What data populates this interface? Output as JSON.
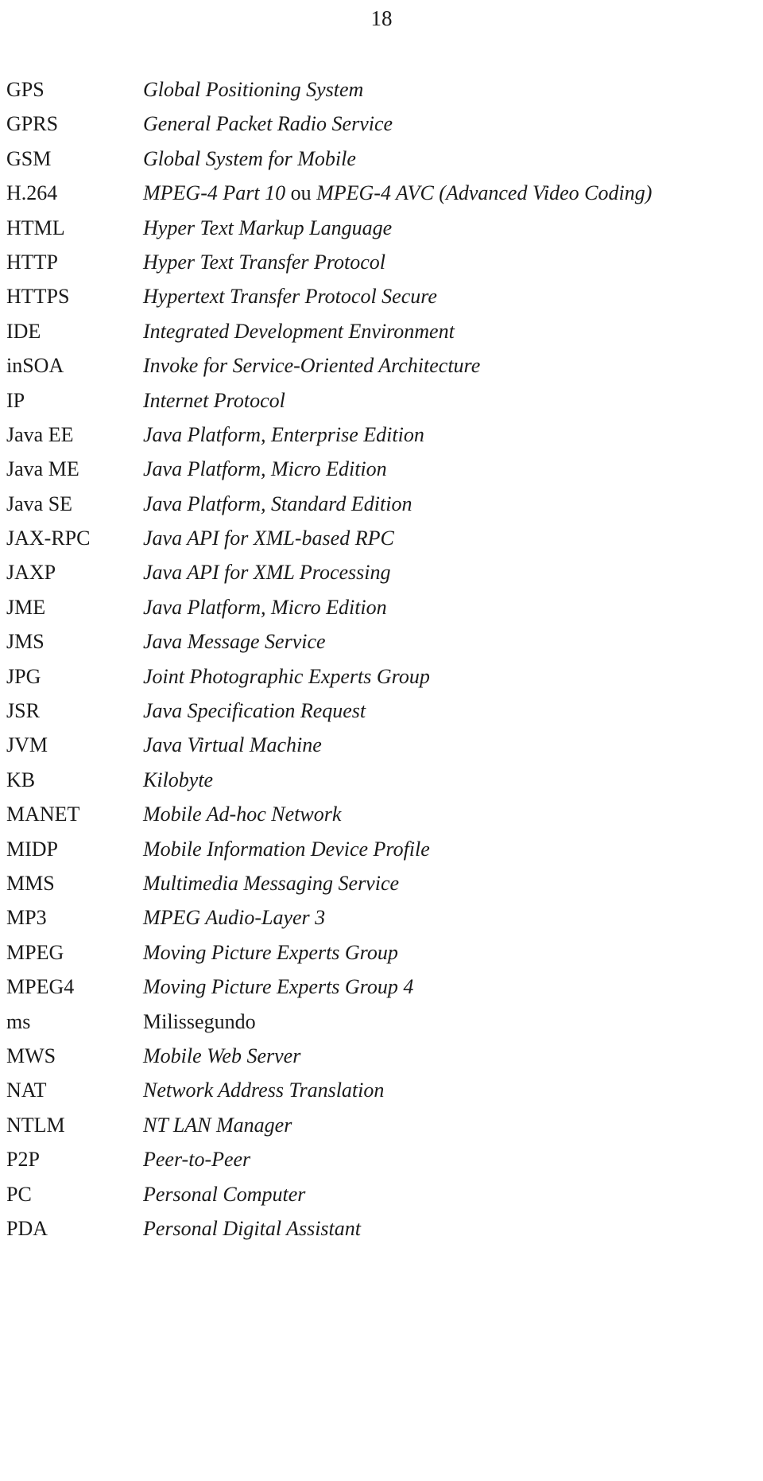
{
  "page": {
    "number": "18"
  },
  "glossary": {
    "entries": [
      {
        "term": "GPS",
        "definition": "Global Positioning System",
        "italic": true
      },
      {
        "term": "GPRS",
        "definition": "General Packet Radio Service",
        "italic": true
      },
      {
        "term": "GSM",
        "definition": "Global System for Mobile",
        "italic": true
      },
      {
        "term": "H.264",
        "definition": "MPEG-4 Part 10 ou MPEG-4 AVC (Advanced Video Coding)",
        "italic": true,
        "roman_segments": [
          "ou"
        ]
      },
      {
        "term": "HTML",
        "definition": "Hyper Text Markup Language",
        "italic": true
      },
      {
        "term": "HTTP",
        "definition": "Hyper Text Transfer Protocol",
        "italic": true
      },
      {
        "term": "HTTPS",
        "definition": "Hypertext Transfer Protocol Secure",
        "italic": true
      },
      {
        "term": "IDE",
        "definition": "Integrated Development Environment",
        "italic": true
      },
      {
        "term": "inSOA",
        "definition": "Invoke for Service-Oriented Architecture",
        "italic": true
      },
      {
        "term": "IP",
        "definition": "Internet Protocol",
        "italic": true
      },
      {
        "term": "Java EE",
        "definition": "Java Platform, Enterprise Edition",
        "italic": true
      },
      {
        "term": "Java ME",
        "definition": "Java Platform, Micro Edition",
        "italic": true
      },
      {
        "term": "Java SE",
        "definition": "Java Platform, Standard Edition",
        "italic": true
      },
      {
        "term": "JAX-RPC",
        "definition": "Java API for XML-based RPC",
        "italic": true
      },
      {
        "term": "JAXP",
        "definition": "Java API for XML Processing",
        "italic": true
      },
      {
        "term": "JME",
        "definition": "Java Platform, Micro Edition",
        "italic": true
      },
      {
        "term": "JMS",
        "definition": "Java Message Service",
        "italic": true
      },
      {
        "term": "JPG",
        "definition": "Joint Photographic Experts Group",
        "italic": true
      },
      {
        "term": "JSR",
        "definition": "Java Specification Request",
        "italic": true
      },
      {
        "term": "JVM",
        "definition": "Java Virtual Machine",
        "italic": true
      },
      {
        "term": "KB",
        "definition": "Kilobyte",
        "italic": true
      },
      {
        "term": "MANET",
        "definition": "Mobile Ad-hoc Network",
        "italic": true
      },
      {
        "term": "MIDP",
        "definition": "Mobile Information Device Profile",
        "italic": true
      },
      {
        "term": "MMS",
        "definition": "Multimedia Messaging Service",
        "italic": true
      },
      {
        "term": "MP3",
        "definition": "MPEG Audio-Layer 3",
        "italic": true
      },
      {
        "term": "MPEG",
        "definition": "Moving Picture Experts Group",
        "italic": true
      },
      {
        "term": "MPEG4",
        "definition": "Moving Picture Experts Group 4",
        "italic": true
      },
      {
        "term": "ms",
        "definition": "Milissegundo",
        "italic": false
      },
      {
        "term": "MWS",
        "definition": "Mobile Web Server",
        "italic": true
      },
      {
        "term": "NAT",
        "definition": "Network Address Translation",
        "italic": true
      },
      {
        "term": "NTLM",
        "definition": "NT LAN Manager",
        "italic": true
      },
      {
        "term": "P2P",
        "definition": "Peer-to-Peer",
        "italic": true
      },
      {
        "term": "PC",
        "definition": "Personal Computer",
        "italic": true
      },
      {
        "term": "PDA",
        "definition": "Personal Digital Assistant",
        "italic": true
      }
    ]
  }
}
